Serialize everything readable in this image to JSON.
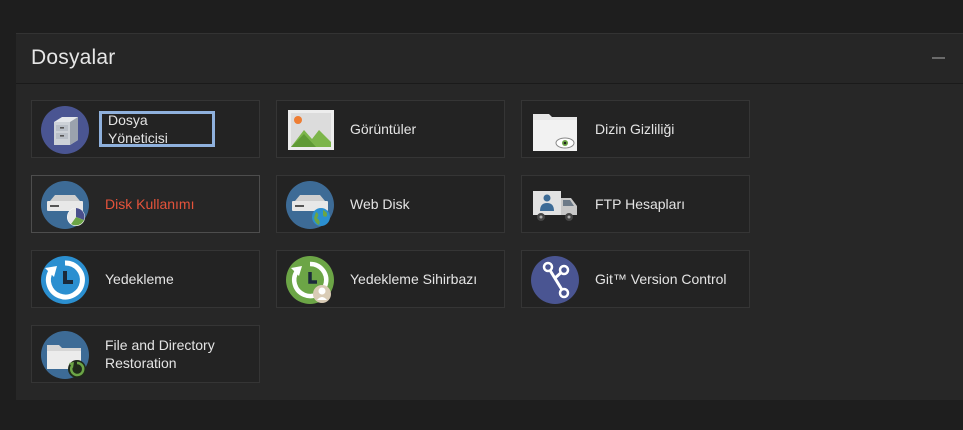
{
  "section": {
    "title": "Dosyalar"
  },
  "tiles": [
    {
      "label": "Dosya Yöneticisi",
      "icon": "file-manager-icon"
    },
    {
      "label": "Görüntüler",
      "icon": "images-icon"
    },
    {
      "label": "Dizin Gizliliği",
      "icon": "directory-privacy-icon"
    },
    {
      "label": "Disk Kullanımı",
      "icon": "disk-usage-icon"
    },
    {
      "label": "Web Disk",
      "icon": "web-disk-icon"
    },
    {
      "label": "FTP Hesapları",
      "icon": "ftp-accounts-icon"
    },
    {
      "label": "Yedekleme",
      "icon": "backup-icon"
    },
    {
      "label": "Yedekleme Sihirbazı",
      "icon": "backup-wizard-icon"
    },
    {
      "label": "Git™ Version Control",
      "icon": "git-icon"
    },
    {
      "label": "File and Directory Restoration",
      "icon": "restore-icon"
    }
  ],
  "colors": {
    "active_label": "#e5533b",
    "focus_ring": "#8fb1dd",
    "icon_circle": "#3d6b96",
    "backup_blue": "#2b8fd0",
    "wizard_green": "#6ca546",
    "git_purple": "#4a5592"
  }
}
